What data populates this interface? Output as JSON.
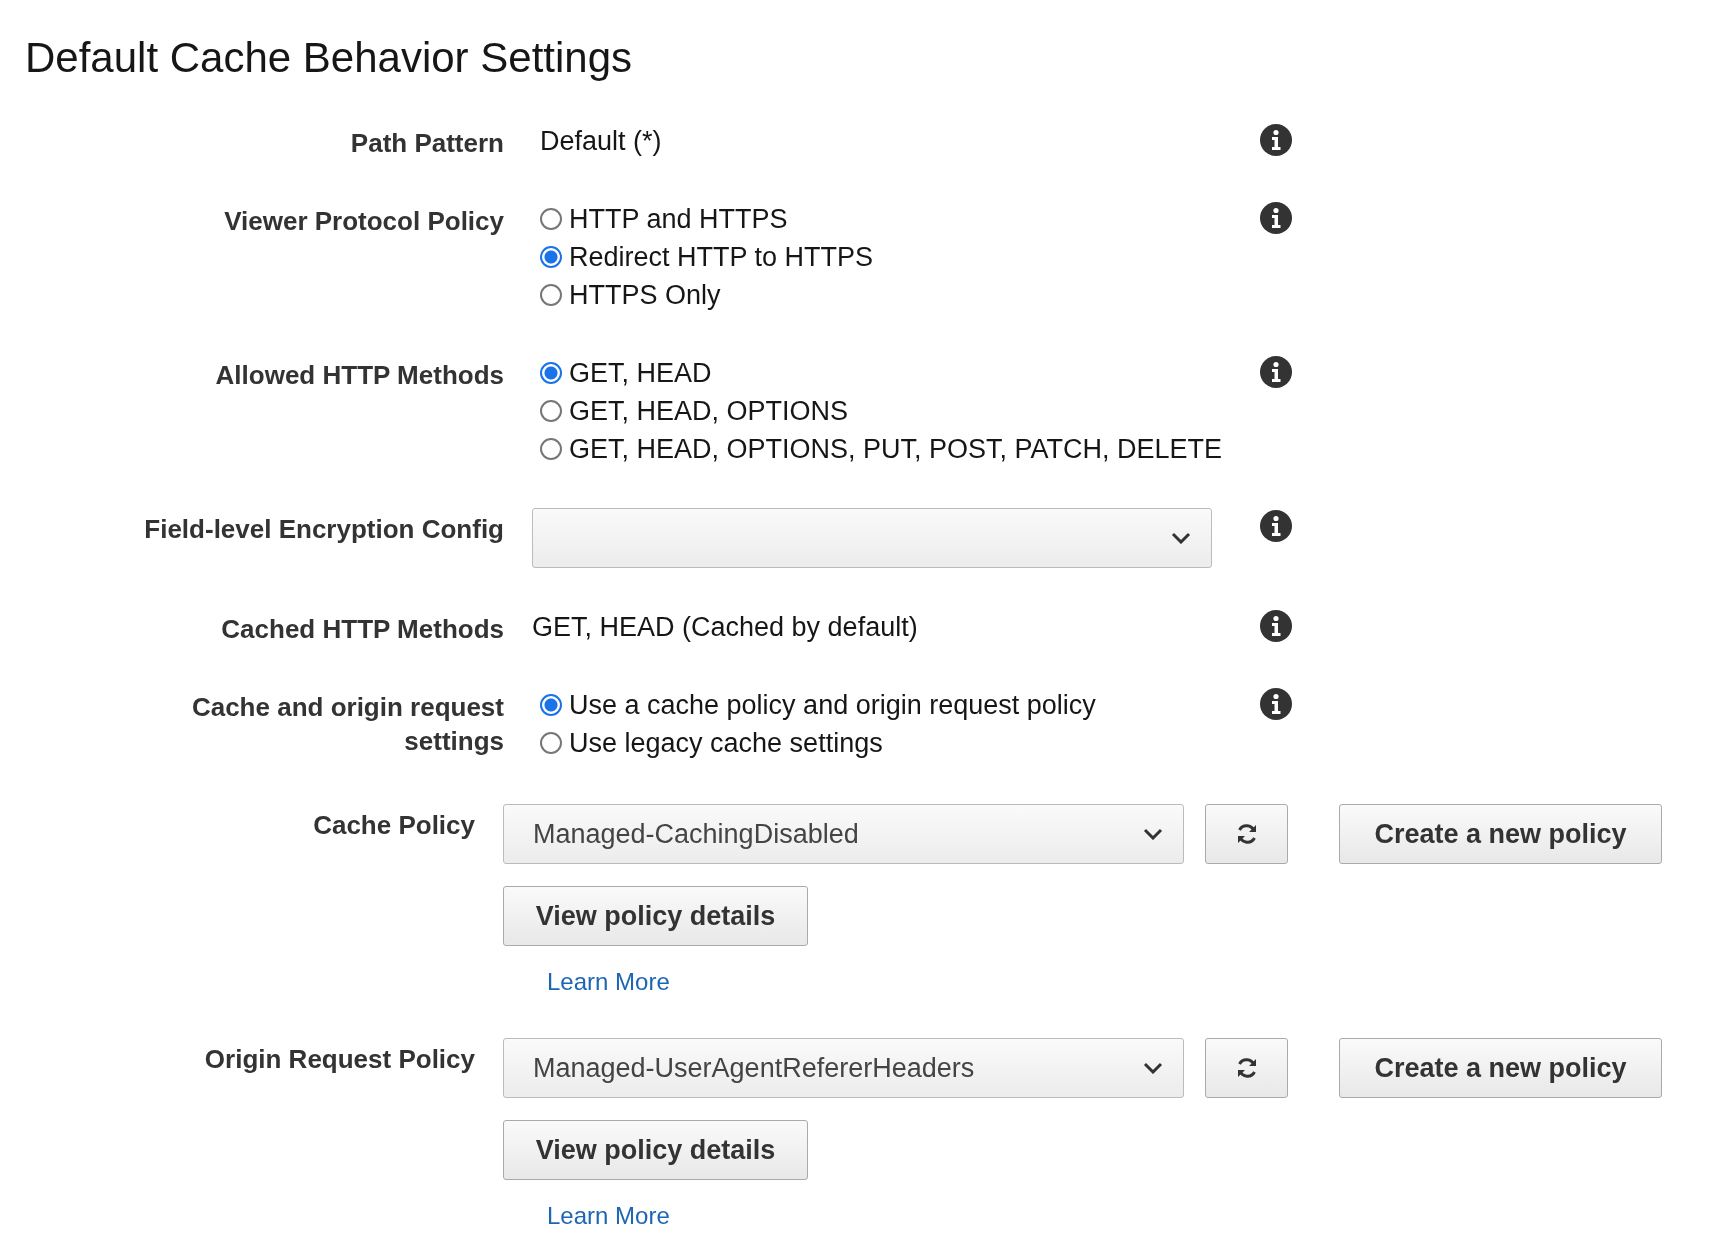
{
  "title": "Default Cache Behavior Settings",
  "settings": [
    {
      "kind": "text",
      "label": "Path Pattern",
      "value": "Default (*)"
    },
    {
      "kind": "radio",
      "label": "Viewer Protocol Policy",
      "options": [
        {
          "label": "HTTP and HTTPS",
          "selected": false
        },
        {
          "label": "Redirect HTTP to HTTPS",
          "selected": true
        },
        {
          "label": "HTTPS Only",
          "selected": false
        }
      ]
    },
    {
      "kind": "radio",
      "label": "Allowed HTTP Methods",
      "options": [
        {
          "label": "GET, HEAD",
          "selected": true
        },
        {
          "label": "GET, HEAD, OPTIONS",
          "selected": false
        },
        {
          "label": "GET, HEAD, OPTIONS, PUT, POST, PATCH, DELETE",
          "selected": false
        }
      ]
    },
    {
      "kind": "select",
      "label": "Field-level Encryption Config"
    },
    {
      "kind": "plain",
      "label": "Cached HTTP Methods",
      "value": "GET, HEAD (Cached by default)"
    },
    {
      "kind": "radio",
      "label": "Cache and origin request settings",
      "options": [
        {
          "label": "Use a cache policy and origin request policy",
          "selected": true
        },
        {
          "label": "Use legacy cache settings",
          "selected": false
        }
      ]
    }
  ],
  "policies": [
    {
      "label": "Cache Policy",
      "value": "Managed-CachingDisabled",
      "create_button": "Create a new policy",
      "details_button": "View policy details",
      "link": "Learn More"
    },
    {
      "label": "Origin Request Policy",
      "value": "Managed-UserAgentRefererHeaders",
      "create_button": "Create a new policy",
      "details_button": "View policy details",
      "link": "Learn More"
    }
  ]
}
